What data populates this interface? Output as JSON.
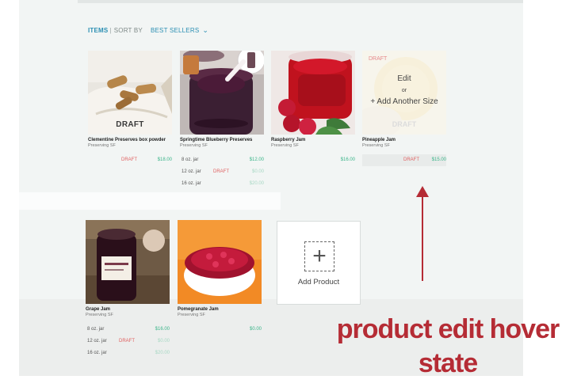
{
  "toolbar": {
    "items_label": "ITEMS",
    "sort_label": "SORT BY",
    "sort_value": "BEST SELLERS"
  },
  "products_row1": [
    {
      "name": "Clementine Preserves box powder",
      "maker": "Preserving SF",
      "image_label": "DRAFT",
      "variants": [
        {
          "size": "",
          "status": "DRAFT",
          "price": "$18.00",
          "faint": false
        }
      ]
    },
    {
      "name": "Springtime Blueberry Preserves",
      "maker": "Preserving SF",
      "image_label": "",
      "variants": [
        {
          "size": "8 oz. jar",
          "status": "",
          "price": "$12.00",
          "faint": false
        },
        {
          "size": "12 oz. jar",
          "status": "DRAFT",
          "price": "$0.00",
          "faint": true
        },
        {
          "size": "16 oz. jar",
          "status": "",
          "price": "$20.00",
          "faint": true
        }
      ]
    },
    {
      "name": "Raspberry Jam",
      "maker": "Preserving SF",
      "image_label": "",
      "variants": [
        {
          "size": "",
          "status": "",
          "price": "$16.00",
          "faint": false
        }
      ]
    }
  ],
  "hover_card": {
    "name": "Pineapple Jam",
    "maker": "Preserving SF",
    "draft_top": "DRAFT",
    "edit": "Edit",
    "or": "or",
    "add_size": "+ Add Another Size",
    "draft_bottom": "DRAFT",
    "status": "DRAFT",
    "price": "$15.00"
  },
  "products_row2": [
    {
      "name": "Grape Jam",
      "maker": "Preserving SF",
      "variants": [
        {
          "size": "8 oz. jar",
          "status": "",
          "price": "$16.00",
          "faint": false
        },
        {
          "size": "12 oz. jar",
          "status": "DRAFT",
          "price": "$0.00",
          "faint": true
        },
        {
          "size": "16 oz. jar",
          "status": "",
          "price": "$20.00",
          "faint": true
        }
      ]
    },
    {
      "name": "Pomegranate Jam",
      "maker": "Preserving SF",
      "variants": [
        {
          "size": "",
          "status": "",
          "price": "$0.00",
          "faint": false
        }
      ]
    }
  ],
  "add_product": {
    "label": "Add Product"
  },
  "annotation": {
    "line1": "product edit hover",
    "line2": "state"
  },
  "colors": {
    "accent": "#2b8fb3",
    "draft": "#e06060",
    "price": "#3cb58a",
    "annotation": "#b52c35"
  }
}
